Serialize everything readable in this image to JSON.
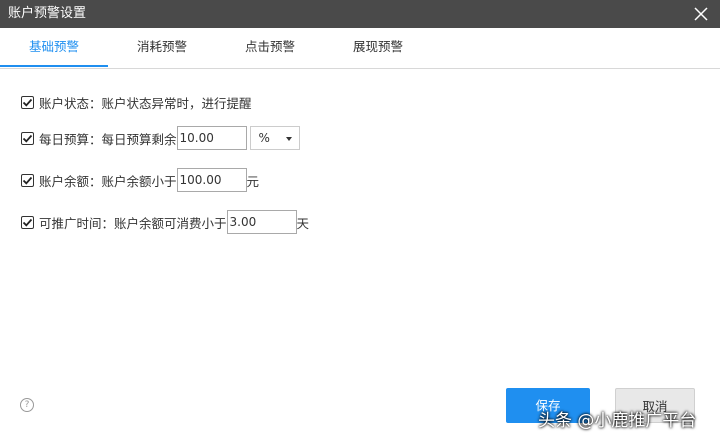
{
  "window": {
    "title": "账户预警设置"
  },
  "tabs": [
    {
      "label": "基础预警",
      "active": true
    },
    {
      "label": "消耗预警",
      "active": false
    },
    {
      "label": "点击预警",
      "active": false
    },
    {
      "label": "展现预警",
      "active": false
    }
  ],
  "settings": {
    "account_status": {
      "label": "账户状态：账户状态异常时，进行提醒",
      "checked": true
    },
    "daily_budget": {
      "label": "每日预算：每日预算剩余",
      "checked": true,
      "value": "10.00",
      "unit_option": "%"
    },
    "account_balance": {
      "label": "账户余额：账户余额小于",
      "checked": true,
      "value": "100.00",
      "suffix": "元"
    },
    "promo_time": {
      "label": "可推广时间：账户余额可消费小于",
      "checked": true,
      "value": "3.00",
      "suffix": "天"
    }
  },
  "footer": {
    "help_symbol": "?",
    "save_label": "保存",
    "cancel_label": "取消"
  },
  "watermark": {
    "text": "头条 @小鹿推广平台"
  },
  "colors": {
    "accent": "#1f8ff0",
    "titlebar": "#4a4a4a"
  }
}
